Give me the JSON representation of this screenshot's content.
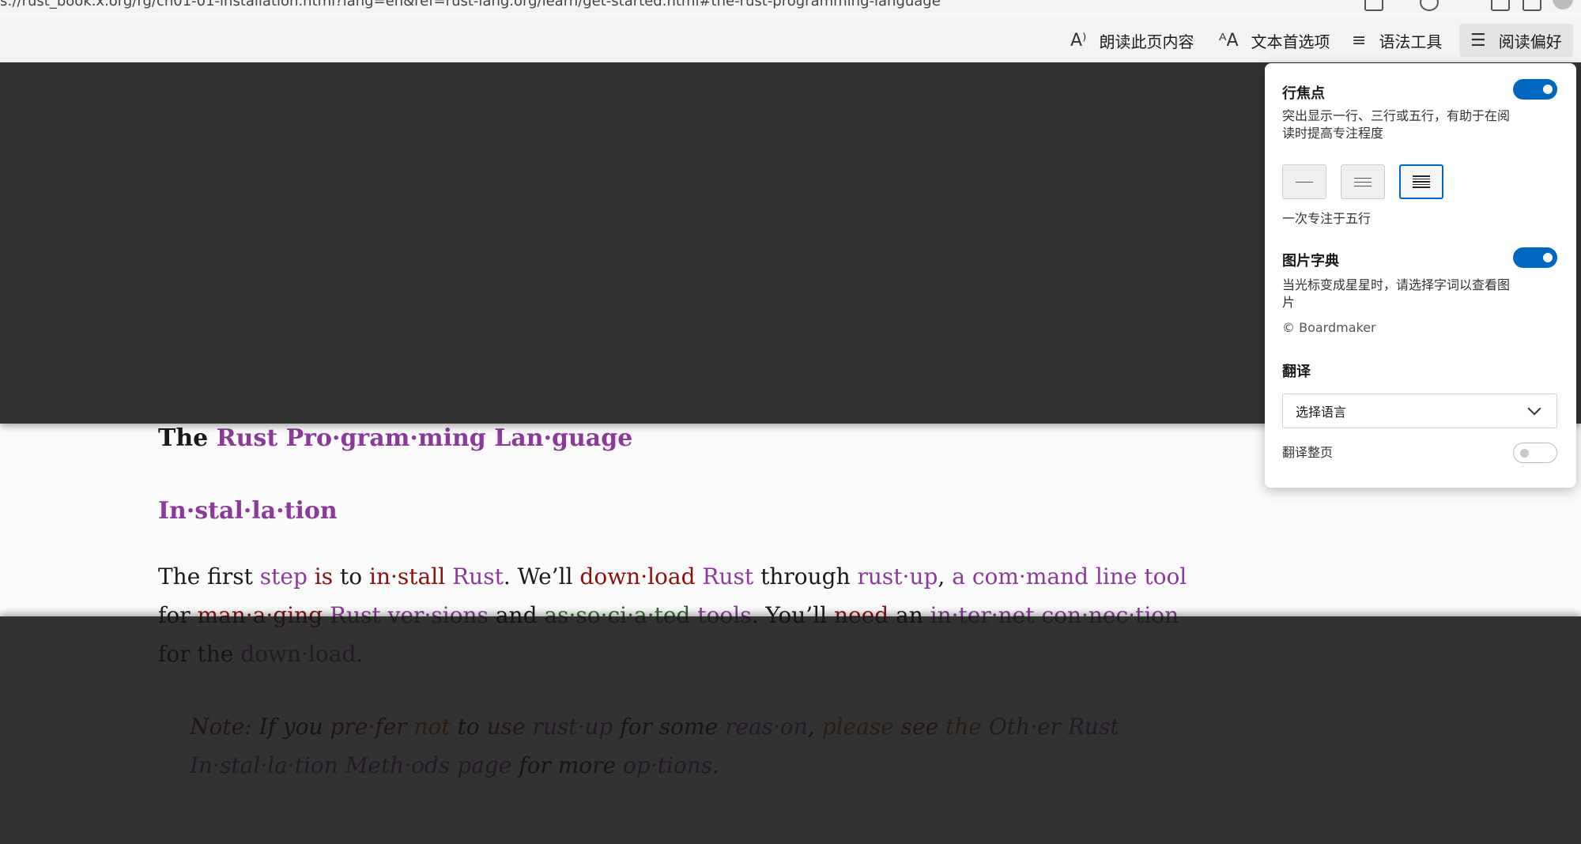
{
  "address_bar": {
    "url": "s://rust_book.x.org/rg/ch01-01-installation.html?lang=en&ref=rust-lang.org/learn/get-started.html#the-rust-programming-language"
  },
  "toolbar": {
    "read_aloud": {
      "icon": "read-aloud-icon",
      "label": "朗读此页内容"
    },
    "text_prefs": {
      "icon": "text-preferences-icon",
      "label": "文本首选项"
    },
    "grammar": {
      "icon": "grammar-tools-icon",
      "label": "语法工具"
    },
    "reading_prefs": {
      "icon": "reading-preferences-icon",
      "label": "阅读偏好"
    }
  },
  "article": {
    "title_prefix": "The",
    "title_rest": "Rust Pro·gram·ming Lan·guage",
    "heading": "In·stal·la·tion",
    "p1": [
      {
        "t": "The first ",
        "c": ""
      },
      {
        "t": "step",
        "c": "pu"
      },
      {
        "t": " ",
        "c": ""
      },
      {
        "t": "is",
        "c": "rd"
      },
      {
        "t": " to ",
        "c": ""
      },
      {
        "t": "in·stall",
        "c": "rd"
      },
      {
        "t": " ",
        "c": ""
      },
      {
        "t": "Rust",
        "c": "pu"
      },
      {
        "t": ". We’ll ",
        "c": ""
      },
      {
        "t": "down·load",
        "c": "rd"
      },
      {
        "t": " ",
        "c": ""
      },
      {
        "t": "Rust",
        "c": "pu"
      },
      {
        "t": " through ",
        "c": ""
      },
      {
        "t": "rust·up",
        "c": "pu"
      },
      {
        "t": ", ",
        "c": ""
      },
      {
        "t": "a com·mand line tool",
        "c": "pu"
      },
      {
        "t": " for ",
        "c": ""
      },
      {
        "t": "man·a·ging",
        "c": "rd"
      },
      {
        "t": " ",
        "c": ""
      },
      {
        "t": "Rust ver·sions",
        "c": "pu"
      },
      {
        "t": " and ",
        "c": ""
      },
      {
        "t": "as·so·ci·a·ted",
        "c": "gr"
      },
      {
        "t": " ",
        "c": ""
      },
      {
        "t": "tools",
        "c": "pu"
      },
      {
        "t": ". You’ll ",
        "c": ""
      },
      {
        "t": "need",
        "c": "rd"
      },
      {
        "t": " an ",
        "c": ""
      },
      {
        "t": "in·ter·net con·nec·tion",
        "c": "pu"
      },
      {
        "t": " for the ",
        "c": ""
      },
      {
        "t": "down·load",
        "c": "pu"
      },
      {
        "t": ".",
        "c": ""
      }
    ],
    "note": [
      {
        "t": "Note:",
        "c": "rd"
      },
      {
        "t": " If you ",
        "c": ""
      },
      {
        "t": "pre·fer",
        "c": "rd"
      },
      {
        "t": " ",
        "c": ""
      },
      {
        "t": "not",
        "c": "or"
      },
      {
        "t": " to ",
        "c": ""
      },
      {
        "t": "use",
        "c": "rd"
      },
      {
        "t": " ",
        "c": ""
      },
      {
        "t": "rust·up",
        "c": "pu"
      },
      {
        "t": " for some ",
        "c": ""
      },
      {
        "t": "reas·on",
        "c": "pu"
      },
      {
        "t": ", ",
        "c": ""
      },
      {
        "t": "please",
        "c": "or"
      },
      {
        "t": " ",
        "c": ""
      },
      {
        "t": "see",
        "c": "rd"
      },
      {
        "t": " ",
        "c": ""
      },
      {
        "t": "the",
        "c": "or"
      },
      {
        "t": " ",
        "c": ""
      },
      {
        "t": "Oth·er",
        "c": "gr"
      },
      {
        "t": " ",
        "c": ""
      },
      {
        "t": "Rust",
        "c": "pu"
      },
      {
        "t": " ",
        "c": ""
      },
      {
        "t": "In·stal·la·tion Meth·ods page",
        "c": "pu"
      },
      {
        "t": " for more ",
        "c": ""
      },
      {
        "t": "op·tions",
        "c": "pu"
      },
      {
        "t": ".",
        "c": ""
      }
    ]
  },
  "panel": {
    "line_focus": {
      "title": "行焦点",
      "desc": "突出显示一行、三行或五行，有助于在阅读时提高专注程度",
      "enabled": true,
      "selected_lines": 5,
      "caption": "一次专注于五行"
    },
    "picture_dict": {
      "title": "图片字典",
      "desc": "当光标变成星星时，请选择字词以查看图片",
      "credit": "© Boardmaker",
      "enabled": true
    },
    "translate": {
      "title": "翻译",
      "select_value": "选择语言",
      "whole_page_label": "翻译整页",
      "whole_page_enabled": false
    }
  },
  "colors": {
    "accent": "#0067c0",
    "purple": "#8b3a9b",
    "red": "#8c1010",
    "green": "#2e6b2e",
    "orange": "#b45a10"
  }
}
